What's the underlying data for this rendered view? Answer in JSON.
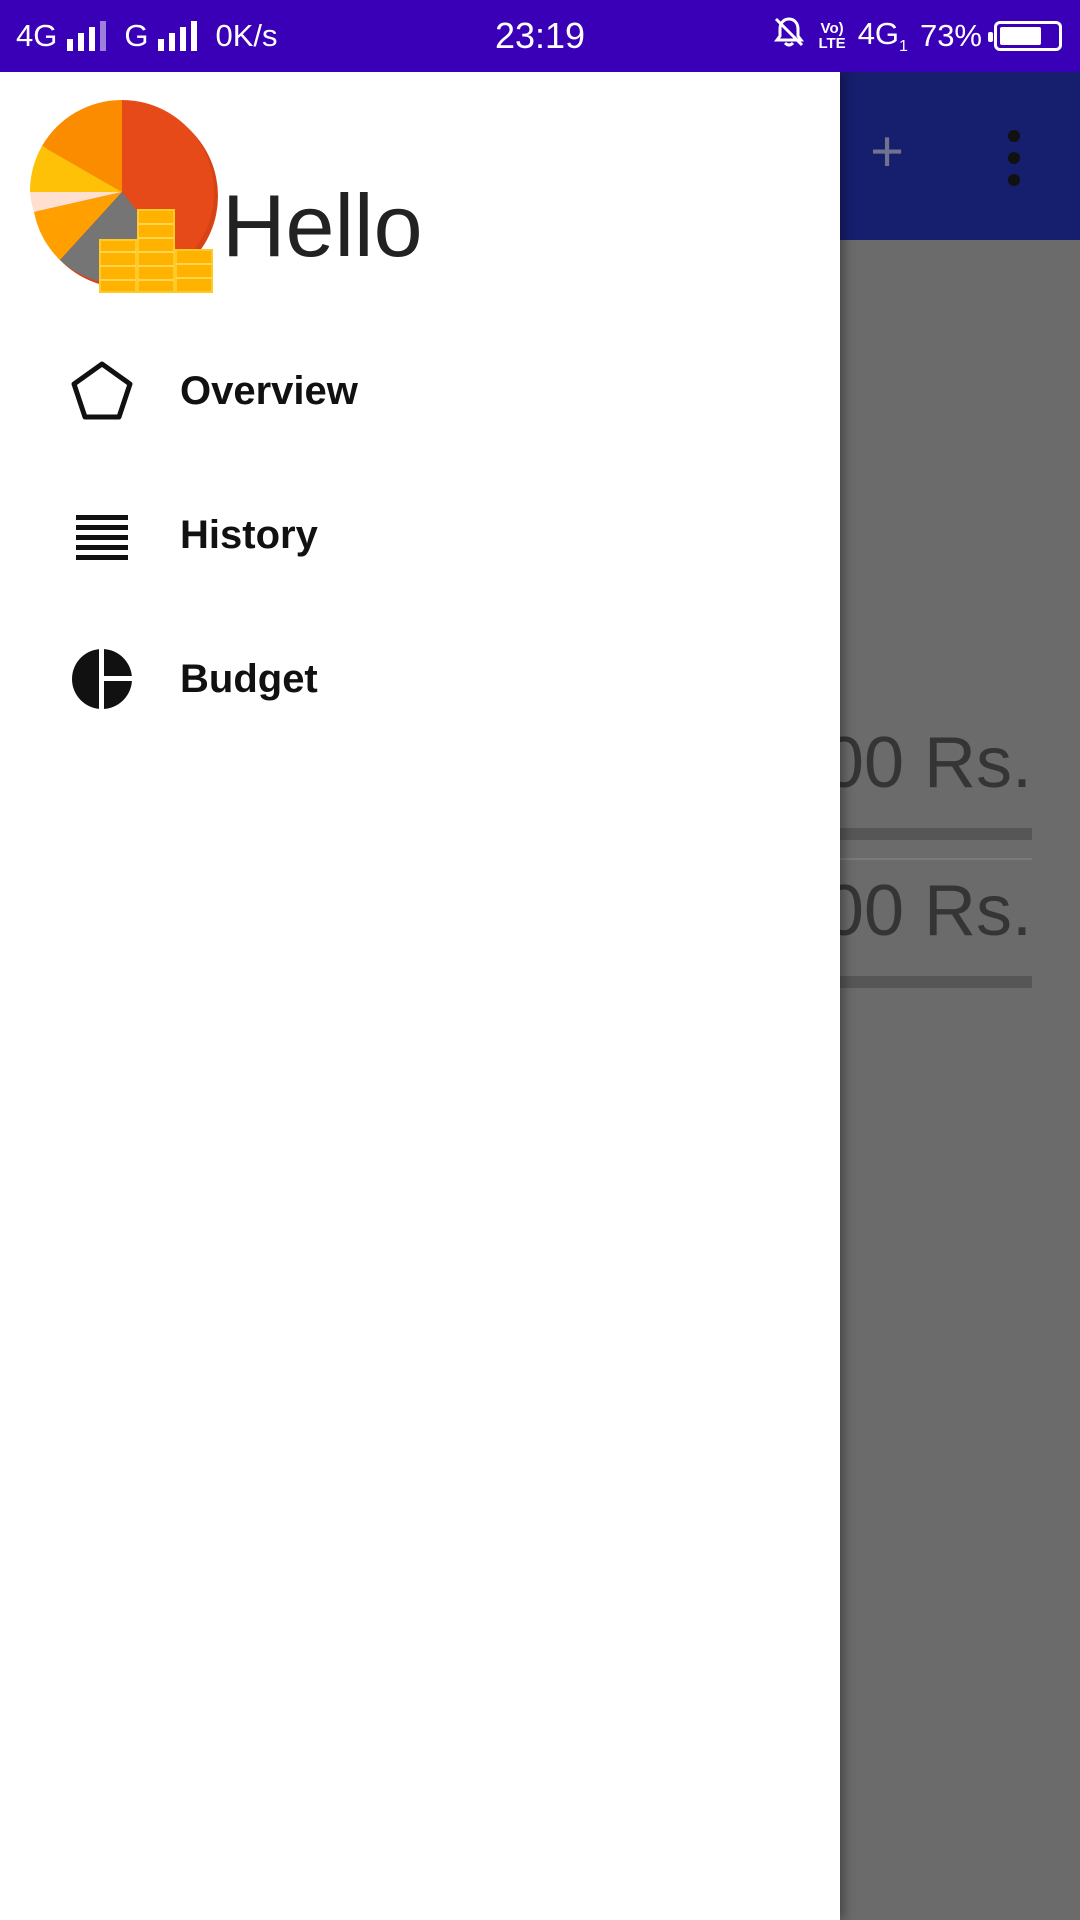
{
  "status_bar": {
    "network1": "4G",
    "network2": "G",
    "speed": "0K/s",
    "time": "23:19",
    "volte_top": "Vo)",
    "volte_bottom": "LTE",
    "network3": "4G",
    "network3_sub": "1",
    "battery": "73%",
    "battery_level": 0.73,
    "icons": [
      "signal-icon",
      "signal-icon",
      "mute-bell-icon",
      "battery-icon"
    ]
  },
  "drawer": {
    "logo_icon": "pie-chart-coins-logo",
    "greeting": "Hello",
    "items": [
      {
        "label": "Overview",
        "icon": "pentagon-icon"
      },
      {
        "label": "History",
        "icon": "list-lines-icon"
      },
      {
        "label": "Budget",
        "icon": "budget-pie-icon"
      }
    ]
  },
  "background_app": {
    "toolbar": {
      "add_label": "+",
      "icons": [
        "plus-icon",
        "more-vert-icon"
      ],
      "color": "#161e6e"
    },
    "amounts": [
      "00 Rs.",
      "00 Rs."
    ]
  },
  "colors": {
    "status_bar": "#3a00b8",
    "scrim": "#6b6b6b",
    "drawer": "#ffffff"
  }
}
